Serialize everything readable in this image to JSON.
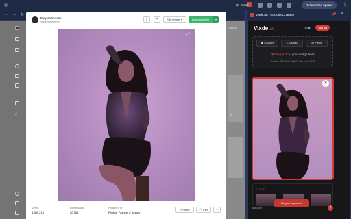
{
  "browser": {
    "url_domain": "unsplash.com",
    "url_path": "/photos/woman-in-purple-long-sleeve-shirt-and-black-skirt-sitting-on-floor-aFdNcPP4OnE",
    "install_label": "Install",
    "relaunch_label": "Relaunch to update"
  },
  "modal": {
    "author_name": "Eleyton Everton",
    "author_handle": "@eleytoneverton",
    "edit_label": "Edit image",
    "download_label": "Download free",
    "stats": {
      "views_label": "Views",
      "views_value": "3,601,213",
      "downloads_label": "Downloads",
      "downloads_value": "20,764",
      "featured_label": "Featured in",
      "featured_value": "Photos, Fashion & Beauty"
    },
    "share_label": "Share",
    "info_label": "Info"
  },
  "background_page": {
    "filters_label": "Filters"
  },
  "panel": {
    "tab_title": "Vixde.art - AI Outfit Changer",
    "logo_main": "Vixde",
    "logo_sub": "art",
    "credits": "70",
    "topup_label": "Top up",
    "capture_label": "Capture",
    "upload_label": "Upload",
    "paste_label": "Paste",
    "drop_prefix": "or ",
    "drop_link": "Drag & drop",
    "drop_suffix": " your image here",
    "accepts": "Accepts: JPG, PNG, WebP - Max size: 10MB",
    "style_label": "STYLE",
    "toast": "Region captured!",
    "account_label": "Account",
    "help_label": "?"
  },
  "colors": {
    "accent_red": "#d83a3a",
    "download_green": "#3cb46e",
    "browser_chrome": "#1f2a44"
  }
}
